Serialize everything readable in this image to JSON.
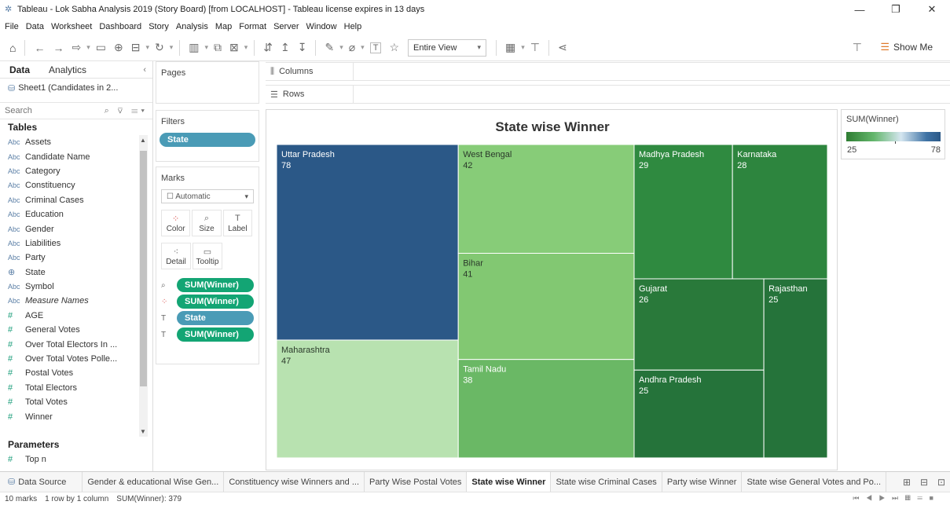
{
  "window": {
    "title": "Tableau - Lok Sabha Analysis 2019 (Story Board) [from LOCALHOST] - Tableau license expires in 13 days",
    "controls": [
      "—",
      "❐",
      "✕"
    ]
  },
  "menu": [
    "File",
    "Data",
    "Worksheet",
    "Dashboard",
    "Story",
    "Analysis",
    "Map",
    "Format",
    "Server",
    "Window",
    "Help"
  ],
  "toolbar": {
    "view_mode": "Entire View",
    "show_me": "Show Me"
  },
  "data_pane": {
    "tabs": [
      "Data",
      "Analytics"
    ],
    "datasource": "Sheet1 (Candidates in 2...",
    "search_placeholder": "Search",
    "tables_header": "Tables",
    "fields": [
      {
        "type": "Abc",
        "name": "Assets"
      },
      {
        "type": "Abc",
        "name": "Candidate Name"
      },
      {
        "type": "Abc",
        "name": "Category"
      },
      {
        "type": "Abc",
        "name": "Constituency"
      },
      {
        "type": "Abc",
        "name": "Criminal Cases"
      },
      {
        "type": "Abc",
        "name": "Education"
      },
      {
        "type": "Abc",
        "name": "Gender"
      },
      {
        "type": "Abc",
        "name": "Liabilities"
      },
      {
        "type": "Abc",
        "name": "Party"
      },
      {
        "type": "globe",
        "name": "State"
      },
      {
        "type": "Abc",
        "name": "Symbol"
      },
      {
        "type": "Abc",
        "name": "Measure Names"
      },
      {
        "type": "#",
        "name": "AGE"
      },
      {
        "type": "#",
        "name": "General Votes"
      },
      {
        "type": "#",
        "name": "Over Total Electors  In ..."
      },
      {
        "type": "#",
        "name": "Over Total Votes Polle..."
      },
      {
        "type": "#",
        "name": "Postal Votes"
      },
      {
        "type": "#",
        "name": "Total Electors"
      },
      {
        "type": "#",
        "name": "Total Votes"
      },
      {
        "type": "#",
        "name": "Winner"
      }
    ],
    "parameters_header": "Parameters",
    "parameters": [
      {
        "type": "#",
        "name": "Top n"
      }
    ]
  },
  "cards": {
    "pages": "Pages",
    "filters": "Filters",
    "filter_pill": "State",
    "marks": "Marks",
    "mark_type": "Automatic",
    "mark_buttons": [
      "Color",
      "Size",
      "Label",
      "Detail",
      "Tooltip"
    ],
    "mark_pills": [
      "SUM(Winner)",
      "SUM(Winner)",
      "State",
      "SUM(Winner)"
    ]
  },
  "shelves": {
    "columns": "Columns",
    "rows": "Rows"
  },
  "legend": {
    "title": "SUM(Winner)",
    "min": "25",
    "max": "78"
  },
  "chart_data": {
    "type": "treemap",
    "title": "State wise Winner",
    "measure": "SUM(Winner)",
    "items": [
      {
        "state": "Uttar Pradesh",
        "value": 78,
        "color": "#2b5887"
      },
      {
        "state": "Maharashtra",
        "value": 47,
        "color": "#b8e2b0"
      },
      {
        "state": "West Bengal",
        "value": 42,
        "color": "#87cc78"
      },
      {
        "state": "Bihar",
        "value": 41,
        "color": "#82c872"
      },
      {
        "state": "Tamil Nadu",
        "value": 38,
        "color": "#6ab865"
      },
      {
        "state": "Madhya Pradesh",
        "value": 29,
        "color": "#2f8a40"
      },
      {
        "state": "Karnataka",
        "value": 28,
        "color": "#2d853e"
      },
      {
        "state": "Gujarat",
        "value": 26,
        "color": "#29793a"
      },
      {
        "state": "Andhra Pradesh",
        "value": 25,
        "color": "#25733a"
      },
      {
        "state": "Rajasthan",
        "value": 25,
        "color": "#25733a"
      }
    ]
  },
  "sheet_tabs": {
    "data_source": "Data Source",
    "tabs": [
      "Gender & educational Wise Gen...",
      "Constituency wise Winners and ...",
      "Party Wise Postal Votes",
      "State wise Winner",
      "State wise Criminal Cases",
      "Party wise Winner",
      "State wise General Votes and Po..."
    ],
    "active": "State wise Winner"
  },
  "status": {
    "marks": "10 marks",
    "rows_cols": "1 row by 1 column",
    "sum": "SUM(Winner): 379"
  }
}
